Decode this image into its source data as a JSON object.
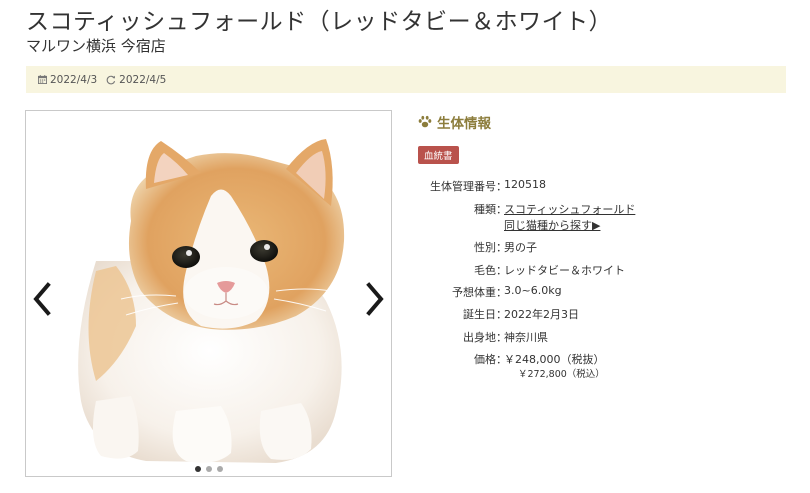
{
  "header": {
    "title": "スコティッシュフォールド（レッドタビー＆ホワイト）",
    "store": "マルワン横浜 今宿店"
  },
  "dates": {
    "posted": "2022/4/3",
    "updated": "2022/4/5"
  },
  "gallery": {
    "slide_count": 3,
    "active_slide": 1
  },
  "info": {
    "heading": "生体情報",
    "badge": "血統書",
    "rows": {
      "id": {
        "label": "生体管理番号",
        "value": "120518"
      },
      "breed": {
        "label": "種類",
        "value": "スコティッシュフォールド",
        "link2": "同じ猫種から探す▶"
      },
      "sex": {
        "label": "性別",
        "value": "男の子"
      },
      "color": {
        "label": "毛色",
        "value": "レッドタビー＆ホワイト"
      },
      "weight": {
        "label": "予想体重",
        "value": "3.0~6.0kg"
      },
      "birthday": {
        "label": "誕生日",
        "value": "2022年2月3日"
      },
      "origin": {
        "label": "出身地",
        "value": "神奈川県"
      },
      "price": {
        "label": "価格",
        "value": "￥248,000（税抜）",
        "with_tax": "￥272,800（税込）"
      }
    }
  },
  "colors": {
    "date_bar_bg": "#f8f5df",
    "heading": "#8c7d3c",
    "badge_bg": "#b9524c"
  }
}
